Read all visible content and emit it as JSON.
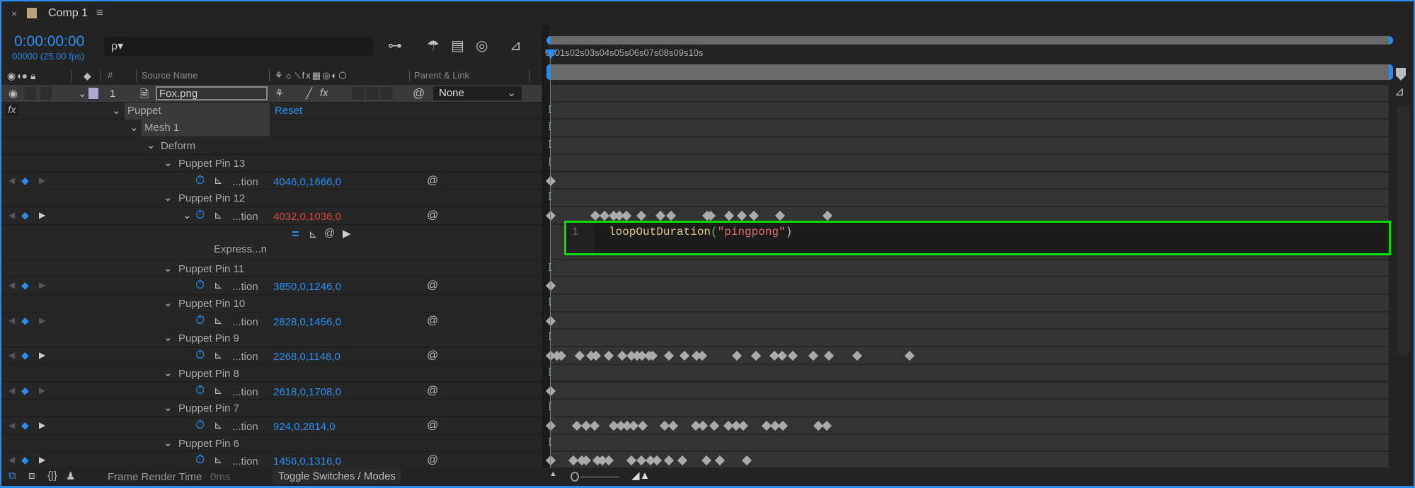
{
  "tab": {
    "title": "Comp 1",
    "close": "×",
    "menu": "≡",
    "swatch_color": "#b6a47f"
  },
  "timecode": {
    "value": "0:00:00:00",
    "frames": "00000 (25.00 fps)"
  },
  "search": {
    "icon": "ρ▾",
    "value": ""
  },
  "columns": {
    "source_name": "Source Name",
    "number": "#",
    "parent_link": "Parent & Link",
    "switches": "⚘☼⟍fx▦◎◐⬡"
  },
  "layer": {
    "number": "1",
    "name": "Fox.png",
    "parent": "None",
    "color": "#a9a9d2",
    "switches_fx": "fx"
  },
  "effect": {
    "fx": "fx",
    "name": "Puppet",
    "reset": "Reset",
    "mesh": "Mesh 1",
    "deform": "Deform"
  },
  "expression": {
    "label": "Express...n",
    "line_number": "1",
    "code_fn": "loopOutDuration",
    "code_paren_open": "(",
    "code_string": "\"pingpong\"",
    "code_paren_close": ")",
    "highlight_color": "#00e000"
  },
  "pins": [
    {
      "name": "Puppet Pin 13",
      "prop": "...tion",
      "value": "4046,0,1666,0",
      "keys": [
        0
      ]
    },
    {
      "name": "Puppet Pin 12",
      "prop": "...tion",
      "value": "4032,0,1036,0",
      "has_expression": true,
      "keys": [
        0,
        0.53,
        0.64,
        0.75,
        0.82,
        0.9,
        1.08,
        1.31,
        1.44,
        1.87,
        1.91,
        2.13,
        2.28,
        2.42,
        2.74,
        3.3
      ]
    },
    {
      "name": "Puppet Pin 11",
      "prop": "...tion",
      "value": "3850,0,1246,0",
      "keys": [
        0
      ]
    },
    {
      "name": "Puppet Pin 10",
      "prop": "...tion",
      "value": "2828,0,1456,0",
      "keys": [
        0
      ]
    },
    {
      "name": "Puppet Pin 9",
      "prop": "...tion",
      "value": "2268,0,1148,0",
      "keys": [
        0,
        0.08,
        0.13,
        0.35,
        0.48,
        0.54,
        0.69,
        0.85,
        0.96,
        1.03,
        1.09,
        1.17,
        1.22,
        1.41,
        1.6,
        1.74,
        1.81,
        2.22,
        2.45,
        2.67,
        2.76,
        2.89,
        3.13,
        3.32,
        3.66,
        4.28
      ]
    },
    {
      "name": "Puppet Pin 8",
      "prop": "...tion",
      "value": "2618,0,1708,0",
      "keys": [
        0
      ]
    },
    {
      "name": "Puppet Pin 7",
      "prop": "...tion",
      "value": "924,0,2814,0",
      "keys": [
        0,
        0.31,
        0.42,
        0.52,
        0.75,
        0.84,
        0.91,
        0.99,
        1.1,
        1.36,
        1.46,
        1.73,
        1.82,
        1.95,
        2.12,
        2.21,
        2.3,
        2.58,
        2.68,
        2.77,
        3.19,
        3.29
      ]
    },
    {
      "name": "Puppet Pin 6",
      "prop": "...tion",
      "value": "1456,0,1316,0",
      "keys": [
        0,
        0.27,
        0.37,
        0.42,
        0.56,
        0.62,
        0.69,
        0.96,
        1.08,
        1.19,
        1.27,
        1.41,
        1.57,
        1.86,
        2.02,
        2.34
      ]
    }
  ],
  "ruler": {
    "labels": [
      "0s",
      "01s",
      "02s",
      "03s",
      "04s",
      "05s",
      "06s",
      "07s",
      "08s",
      "09s",
      "10s"
    ],
    "current_time_s": 0,
    "duration_s": 10
  },
  "bottom": {
    "frame_render_label": "Frame Render Time",
    "frame_render_value": "0ms",
    "toggle": "Toggle Switches / Modes",
    "zoom_level": 0.05
  },
  "colors": {
    "accent": "#2d8ceb",
    "value_red": "#d9453b",
    "keyframe": "#aaaaaa"
  }
}
